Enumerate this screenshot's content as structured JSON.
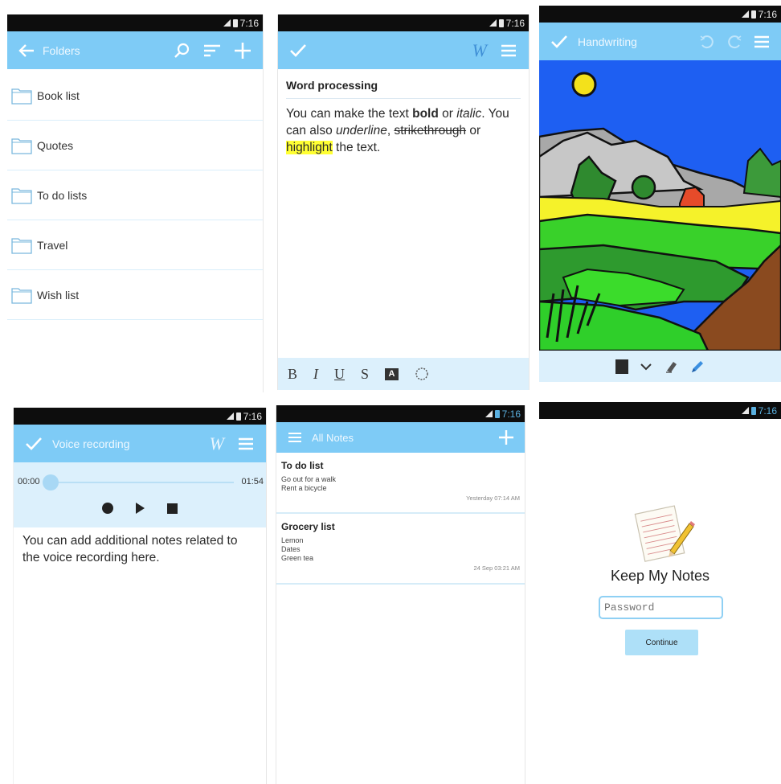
{
  "status": {
    "time": "7:16"
  },
  "folders_screen": {
    "title": "Folders",
    "folders": [
      "Book list",
      "Quotes",
      "To do lists",
      "Travel",
      "Wish list"
    ]
  },
  "word_screen": {
    "heading": "Word processing",
    "text": {
      "p1": "You can make the text ",
      "bold": "bold",
      "p2": " or ",
      "italic": "italic",
      "p3": ". You can also ",
      "underline": "underline",
      "p4": ", ",
      "strike": "strikethrough",
      "p5": " or ",
      "highlight": "highlight",
      "p6": " the text."
    },
    "toolbar": {
      "bold": "B",
      "italic": "I",
      "underline": "U",
      "strike": "S",
      "text_color": "A"
    },
    "w_icon": "W"
  },
  "hand_screen": {
    "title": "Handwriting"
  },
  "voice_screen": {
    "title": "Voice recording",
    "time_start": "00:00",
    "time_end": "01:54",
    "progress": 0,
    "note_text": "You can add additional notes related to the voice recording here.",
    "w_icon": "W"
  },
  "allnotes_screen": {
    "title": "All Notes",
    "notes": [
      {
        "title": "To do list",
        "lines": [
          "Go out for a walk",
          "Rent a bicycle"
        ],
        "time": "Yesterday 07:14 AM"
      },
      {
        "title": "Grocery list",
        "lines": [
          "Lemon",
          "Dates",
          "Green tea"
        ],
        "time": "24 Sep 03:21 AM"
      }
    ]
  },
  "login_screen": {
    "app_name": "Keep My Notes",
    "password_placeholder": "Password",
    "continue_label": "Continue"
  },
  "colors": {
    "appbar": "#7ecbf6",
    "accent": "#4aa7e8",
    "highlight": "#ffff33"
  }
}
